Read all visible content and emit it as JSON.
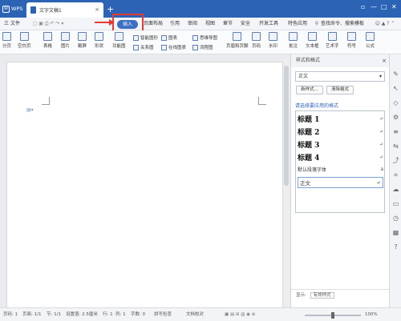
{
  "titlebar": {
    "app_label": "WPS",
    "doc_tab": "文字文稿1",
    "new_tab": "+",
    "win_controls": [
      "▫",
      "—",
      "□",
      "✕"
    ]
  },
  "menubar": {
    "file_label": "三 文件",
    "items": [
      "插入",
      "页面布局",
      "引用",
      "审阅",
      "视图",
      "章节",
      "安全",
      "开发工具",
      "特色应用"
    ],
    "active": "插入",
    "search_placeholder": "查找命令、搜索模板",
    "accent_color": "#3d6fc1",
    "highlight_color": "#e53a32"
  },
  "ribbon": {
    "big_buttons": [
      "分页",
      "空白页",
      "表格",
      "图片",
      "截屏",
      "形状",
      "功能图"
    ],
    "small_group_1": [
      "智能图形",
      "关系图"
    ],
    "small_group_2": [
      "图表",
      "在线图表"
    ],
    "small_group_3": [
      "思维导图",
      "流程图"
    ],
    "big_buttons_2": [
      "页眉和页脚",
      "页码",
      "水印",
      "批注",
      "文本框",
      "艺术字",
      "符号",
      "公式"
    ]
  },
  "panel": {
    "title": "样式和格式",
    "current_style": "正文",
    "new_style_btn": "新样式...",
    "clear_format_btn": "清除格式",
    "apply_label": "请选择要应用的格式",
    "styles": [
      {
        "name": "标题 1",
        "mark": "↵"
      },
      {
        "name": "标题 2",
        "mark": "↵"
      },
      {
        "name": "标题 3",
        "mark": "↵"
      },
      {
        "name": "标题 4",
        "mark": "↵"
      },
      {
        "name": "默认段落字体",
        "mark": "a"
      },
      {
        "name": "正文",
        "mark": "↵"
      }
    ],
    "show_label": "显示:",
    "show_value": "有效样式"
  },
  "statusbar": {
    "page": "页码: 1",
    "pages": "页面: 1/1",
    "section": "节: 1/1",
    "setting": "设置值: 2.5厘米",
    "row": "行: 1",
    "col": "列: 1",
    "words": "字数: 0",
    "spell": "拼写检查",
    "proof": "文档校对",
    "zoom": "100%"
  }
}
